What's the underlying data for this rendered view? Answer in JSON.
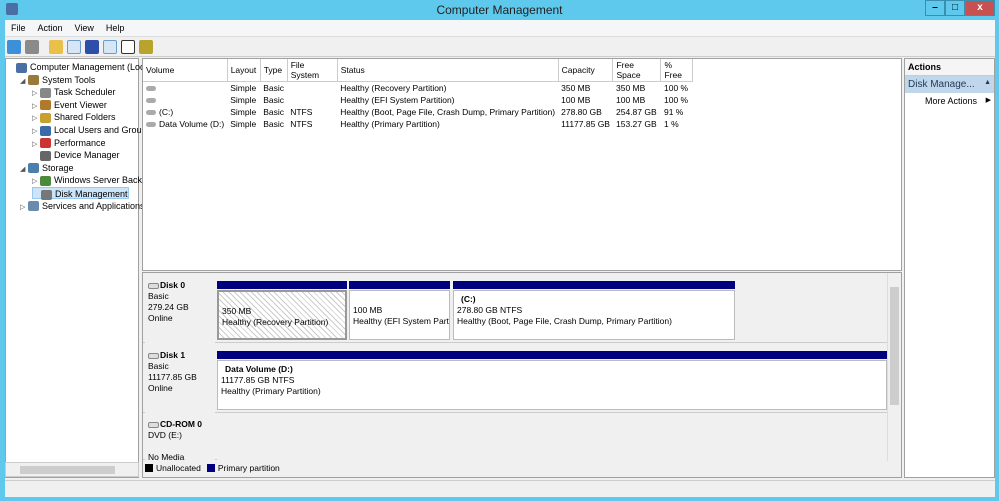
{
  "window": {
    "title": "Computer Management",
    "minimize": "–",
    "maximize": "□",
    "close": "x"
  },
  "menu": [
    "File",
    "Action",
    "View",
    "Help"
  ],
  "toolbar": [
    "back-icon",
    "forward-icon",
    "up-folder-icon",
    "show-hide-tree-icon",
    "help-icon",
    "show-hide-action-icon",
    "refresh-icon",
    "properties-icon"
  ],
  "tree": [
    {
      "label": "Computer Management (Local",
      "level": 0,
      "expander": ""
    },
    {
      "label": "System Tools",
      "level": 1,
      "expander": "◢"
    },
    {
      "label": "Task Scheduler",
      "level": 2,
      "expander": "▷"
    },
    {
      "label": "Event Viewer",
      "level": 2,
      "expander": "▷"
    },
    {
      "label": "Shared Folders",
      "level": 2,
      "expander": "▷"
    },
    {
      "label": "Local Users and Groups",
      "level": 2,
      "expander": "▷"
    },
    {
      "label": "Performance",
      "level": 2,
      "expander": "▷"
    },
    {
      "label": "Device Manager",
      "level": 2,
      "expander": ""
    },
    {
      "label": "Storage",
      "level": 1,
      "expander": "◢"
    },
    {
      "label": "Windows Server Backup",
      "level": 2,
      "expander": "▷"
    },
    {
      "label": "Disk Management",
      "level": 2,
      "expander": "",
      "selected": true
    },
    {
      "label": "Services and Applications",
      "level": 1,
      "expander": "▷"
    }
  ],
  "volumes": {
    "columns": [
      "Volume",
      "Layout",
      "Type",
      "File System",
      "Status",
      "Capacity",
      "Free Space",
      "% Free"
    ],
    "rows": [
      [
        "",
        "Simple",
        "Basic",
        "",
        "Healthy (Recovery Partition)",
        "350 MB",
        "350 MB",
        "100 %"
      ],
      [
        "",
        "Simple",
        "Basic",
        "",
        "Healthy (EFI System Partition)",
        "100 MB",
        "100 MB",
        "100 %"
      ],
      [
        "(C:)",
        "Simple",
        "Basic",
        "NTFS",
        "Healthy (Boot, Page File, Crash Dump, Primary Partition)",
        "278.80 GB",
        "254.87 GB",
        "91 %"
      ],
      [
        "Data Volume (D:)",
        "Simple",
        "Basic",
        "NTFS",
        "Healthy (Primary Partition)",
        "11177.85 GB",
        "153.27 GB",
        "1 %"
      ]
    ]
  },
  "disks": [
    {
      "name": "Disk 0",
      "type": "Basic",
      "size": "279.24 GB",
      "state": "Online",
      "partitions": [
        {
          "title": "",
          "size": "350 MB",
          "status": "Healthy (Recovery Partition)"
        },
        {
          "title": "",
          "size": "100 MB",
          "status": "Healthy (EFI System Parti"
        },
        {
          "title": "(C:)",
          "size": "278.80 GB NTFS",
          "status": "Healthy (Boot, Page File, Crash Dump, Primary Partition)"
        }
      ]
    },
    {
      "name": "Disk 1",
      "type": "Basic",
      "size": "11177.85 GB",
      "state": "Online",
      "partitions": [
        {
          "title": "Data Volume  (D:)",
          "size": "11177.85 GB NTFS",
          "status": "Healthy (Primary Partition)"
        }
      ]
    },
    {
      "name": "CD-ROM 0",
      "type": "DVD (E:)",
      "state": "No Media"
    }
  ],
  "legend": [
    {
      "label": "Unallocated",
      "color": "#000000"
    },
    {
      "label": "Primary partition",
      "color": "#00007f"
    }
  ],
  "actions": {
    "header": "Actions",
    "section": "Disk Manage...",
    "items": [
      "More Actions"
    ]
  },
  "colors": {
    "titlebar": "#5ec9ec",
    "primary": "#00007f",
    "close": "#c75050"
  }
}
